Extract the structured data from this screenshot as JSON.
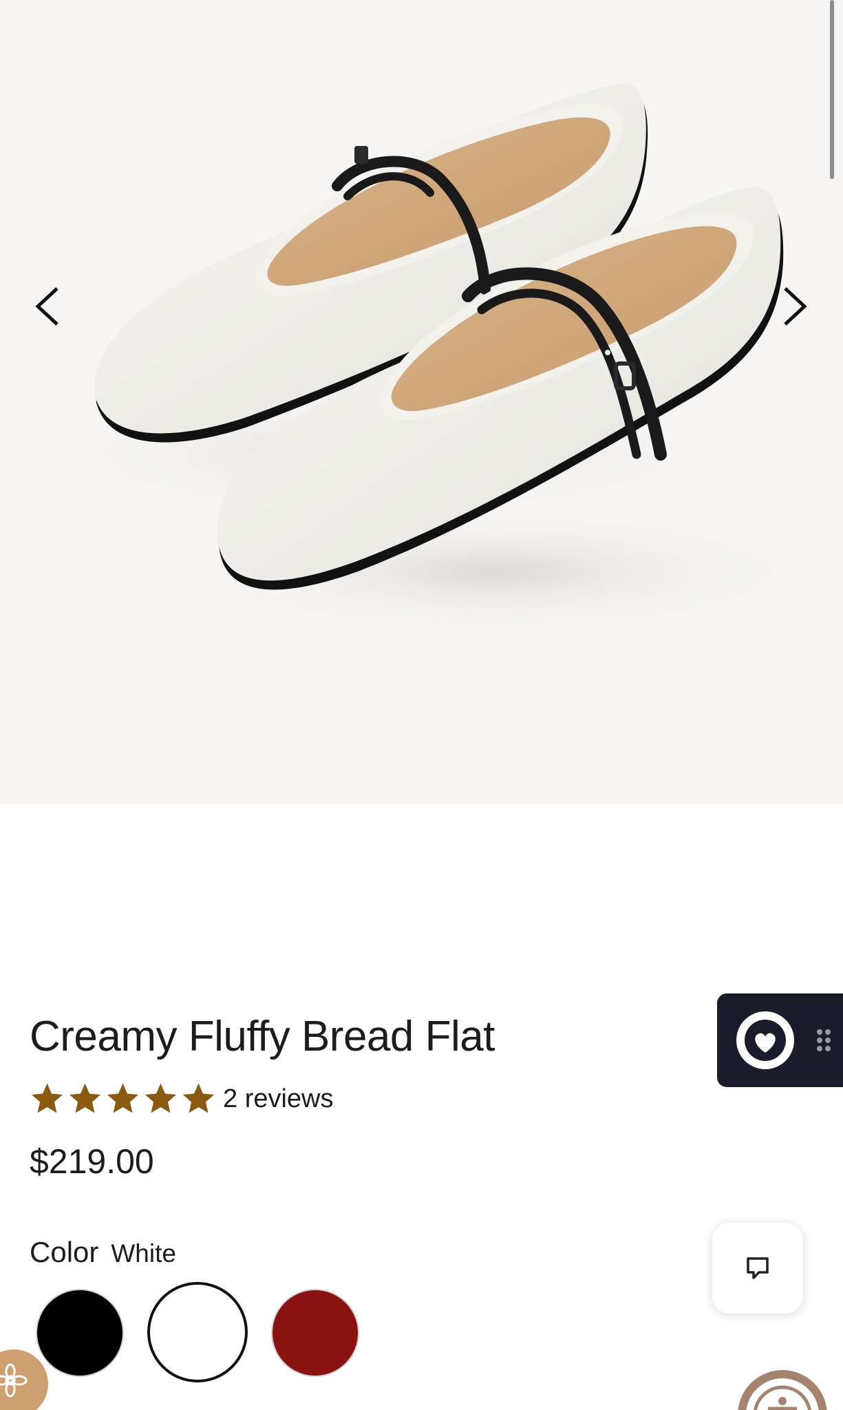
{
  "gallery": {
    "image_alt": "White Mary Jane flats with black double straps",
    "prev_icon": "chevron-left-icon",
    "next_icon": "chevron-right-icon"
  },
  "product": {
    "title": "Creamy Fluffy Bread Flat",
    "rating": 5,
    "rating_max": 5,
    "reviews_label": "2 reviews",
    "price": "$219.00"
  },
  "color": {
    "label": "Color",
    "selected": "White",
    "options": [
      {
        "name": "Black",
        "hex": "#000000"
      },
      {
        "name": "White",
        "hex": "#ffffff"
      },
      {
        "name": "Red",
        "hex": "#8a1210"
      }
    ]
  },
  "colors": {
    "star": "#8a5a10",
    "widget_bg": "#1b1c2b",
    "gallery_bg": "#f6f5f3"
  },
  "widgets": {
    "rewards_icon": "heart-aperture-icon",
    "drag_icon": "drag-handle-icon",
    "chat_icon": "chat-bubble-icon",
    "flower_icon": "flower-icon",
    "accessibility_icon": "accessibility-icon"
  }
}
